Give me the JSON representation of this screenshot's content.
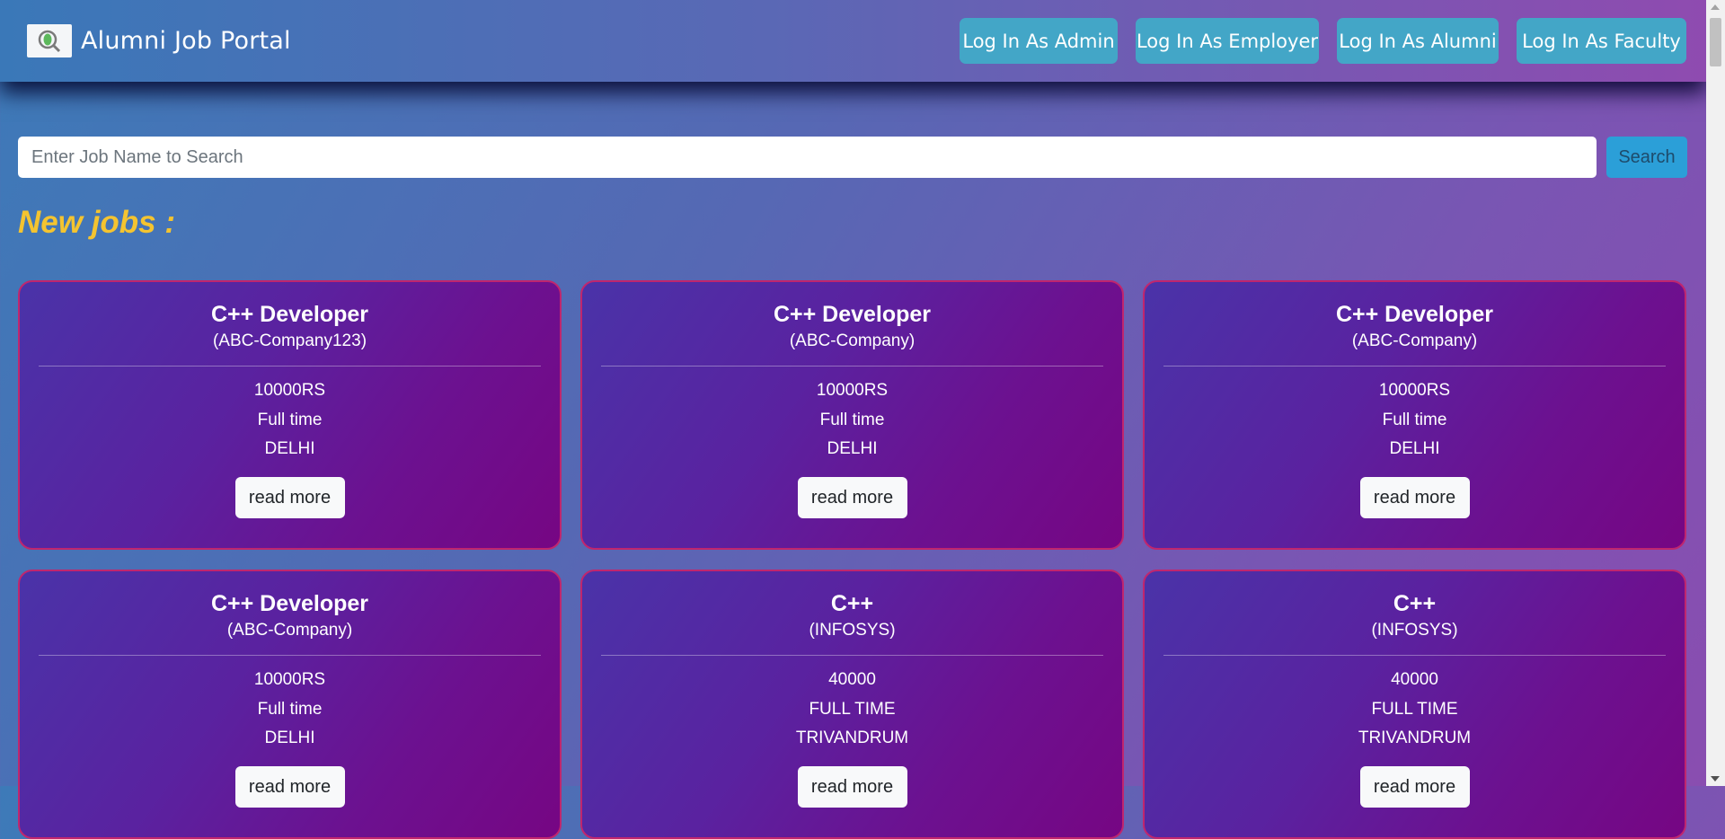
{
  "navbar": {
    "brand": "Alumni Job Portal",
    "buttons": [
      "Log In As Admin",
      "Log In As Employer",
      "Log In As Alumni",
      "Log In As Faculty"
    ]
  },
  "search": {
    "placeholder": "Enter Job Name to Search",
    "button": "Search"
  },
  "section_title": "New jobs :",
  "jobs": [
    {
      "title": "C++ Developer",
      "company": "(ABC-Company123)",
      "salary": "10000RS",
      "type": "Full time",
      "location": "DELHI",
      "action": "read more"
    },
    {
      "title": "C++ Developer",
      "company": "(ABC-Company)",
      "salary": "10000RS",
      "type": "Full time",
      "location": "DELHI",
      "action": "read more"
    },
    {
      "title": "C++ Developer",
      "company": "(ABC-Company)",
      "salary": "10000RS",
      "type": "Full time",
      "location": "DELHI",
      "action": "read more"
    },
    {
      "title": "C++ Developer",
      "company": "(ABC-Company)",
      "salary": "10000RS",
      "type": "Full time",
      "location": "DELHI",
      "action": "read more"
    },
    {
      "title": "C++",
      "company": "(INFOSYS)",
      "salary": "40000",
      "type": "FULL TIME",
      "location": "TRIVANDRUM",
      "action": "read more"
    },
    {
      "title": "C++",
      "company": "(INFOSYS)",
      "salary": "40000",
      "type": "FULL TIME",
      "location": "TRIVANDRUM",
      "action": "read more"
    }
  ],
  "colors": {
    "nav_button": "#43a6c7",
    "search_button": "#2b9fd8",
    "section_title": "#f4c430",
    "card_border": "#c0266e"
  }
}
